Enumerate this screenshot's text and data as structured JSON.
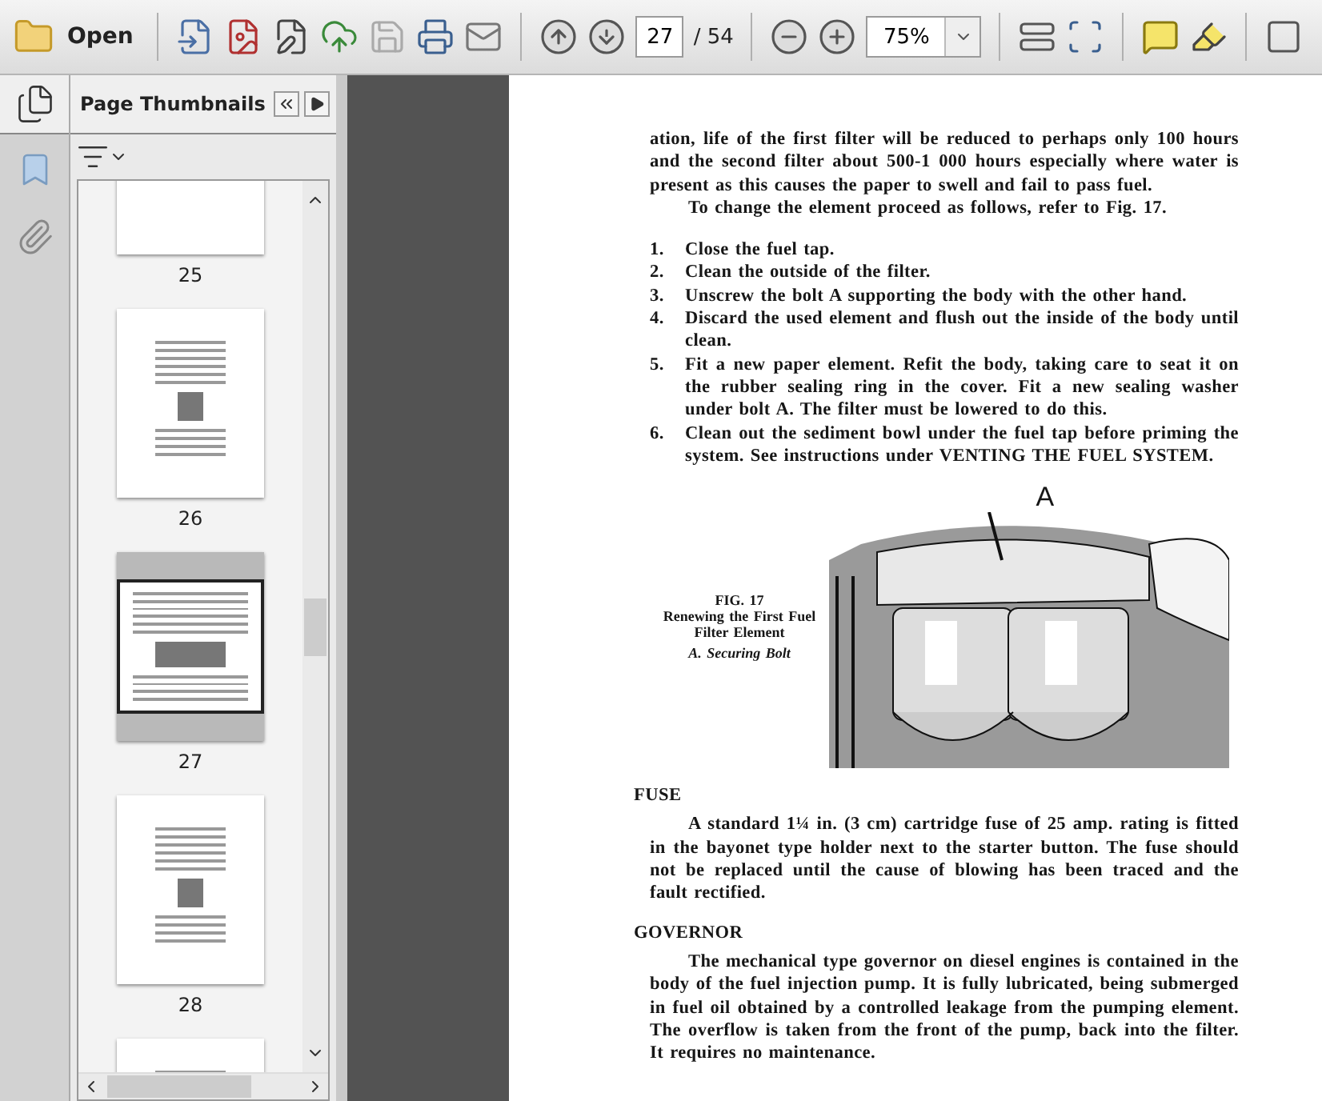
{
  "toolbar": {
    "open_label": "Open",
    "page_number": "27",
    "page_total": "/ 54",
    "zoom": "75%"
  },
  "sidebar": {
    "title": "Page Thumbnails",
    "thumbnails": [
      {
        "label": "25",
        "selected": false
      },
      {
        "label": "26",
        "selected": false
      },
      {
        "label": "27",
        "selected": true
      },
      {
        "label": "28",
        "selected": false
      }
    ]
  },
  "document": {
    "intro": [
      {
        "text": "ation, life of the first filter will be reduced to perhaps only 100 hours and the second filter about 500-1 000 hours especially where water is present as this causes the paper to swell and fail to pass fuel.",
        "indent": false
      },
      {
        "text": "To change the element proceed as follows, refer to Fig. 17.",
        "indent": true
      }
    ],
    "steps": [
      {
        "number": "1.",
        "text": "Close the fuel tap."
      },
      {
        "number": "2.",
        "text": "Clean the outside of the filter."
      },
      {
        "number": "3.",
        "text": "Unscrew the bolt A supporting the body with the other hand."
      },
      {
        "number": "4.",
        "text": "Discard the used element and flush out the inside of the body until clean."
      },
      {
        "number": "5.",
        "text": "Fit a new paper element.   Refit the body, taking care to seat it on the rubber sealing ring in the cover.   Fit a new sealing washer under bolt A.   The filter must be lowered to do this."
      },
      {
        "number": "6.",
        "text": "Clean out the sediment bowl under the fuel tap before priming the system.   See instructions under VENTING THE FUEL SYSTEM."
      }
    ],
    "figure": {
      "callout": "A",
      "title": "FIG. 17",
      "subtitle": "Renewing the First Fuel Filter Element",
      "note": "A.   Securing Bolt"
    },
    "sections": [
      {
        "heading": "FUSE",
        "text": "A standard 1¼ in. (3 cm) cartridge fuse of 25 amp. rating is fitted in the bayonet type holder next to the starter button.   The fuse should not be replaced until the cause of blowing has been traced and the fault rectified."
      },
      {
        "heading": "GOVERNOR",
        "text": "The mechanical type governor on diesel engines is contained in the body of the fuel injection pump.   It is fully lubricated, being submerged in fuel oil obtained by a controlled leakage from the pumping element.   The overflow is taken from the front of the pump, back into the filter.   It requires no maintenance."
      }
    ]
  }
}
